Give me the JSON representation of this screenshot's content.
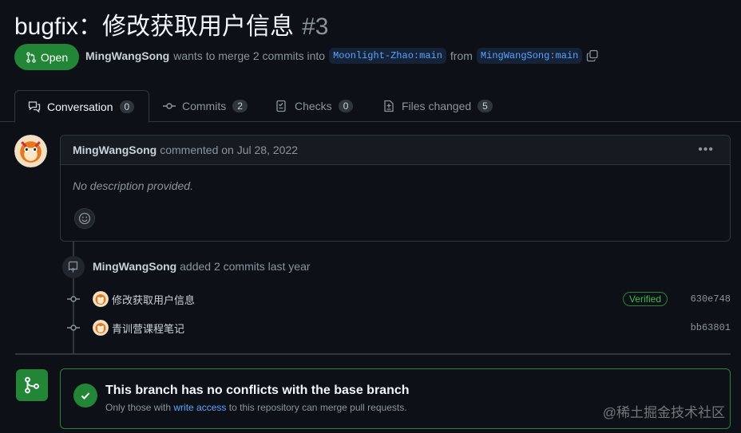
{
  "pr": {
    "title": "bugfix：修改获取用户信息",
    "number": "#3",
    "state": "Open",
    "author": "MingWangSong",
    "merge_text": "wants to merge 2 commits into",
    "base_branch": "Moonlight-Zhao:main",
    "from_text": "from",
    "head_branch": "MingWangSong:main"
  },
  "tabs": [
    {
      "label": "Conversation",
      "count": "0"
    },
    {
      "label": "Commits",
      "count": "2"
    },
    {
      "label": "Checks",
      "count": "0"
    },
    {
      "label": "Files changed",
      "count": "5"
    }
  ],
  "comment": {
    "author": "MingWangSong",
    "meta": "commented on Jul 28, 2022",
    "body": "No description provided."
  },
  "event": {
    "author": "MingWangSong",
    "text": "added 2 commits last year"
  },
  "commits": [
    {
      "message": "修改获取用户信息",
      "verified": "Verified",
      "sha": "630e748"
    },
    {
      "message": "青训营课程笔记",
      "sha": "bb63801"
    }
  ],
  "merge": {
    "title": "This branch has no conflicts with the base branch",
    "sub_before": "Only those with",
    "sub_link": "write access",
    "sub_after": "to this repository can merge pull requests."
  },
  "watermark": "@稀土掘金技术社区",
  "colors": {
    "background": "#0d1117",
    "accent_green": "#238636",
    "link_blue": "#58a6ff",
    "muted": "#8b949e"
  }
}
